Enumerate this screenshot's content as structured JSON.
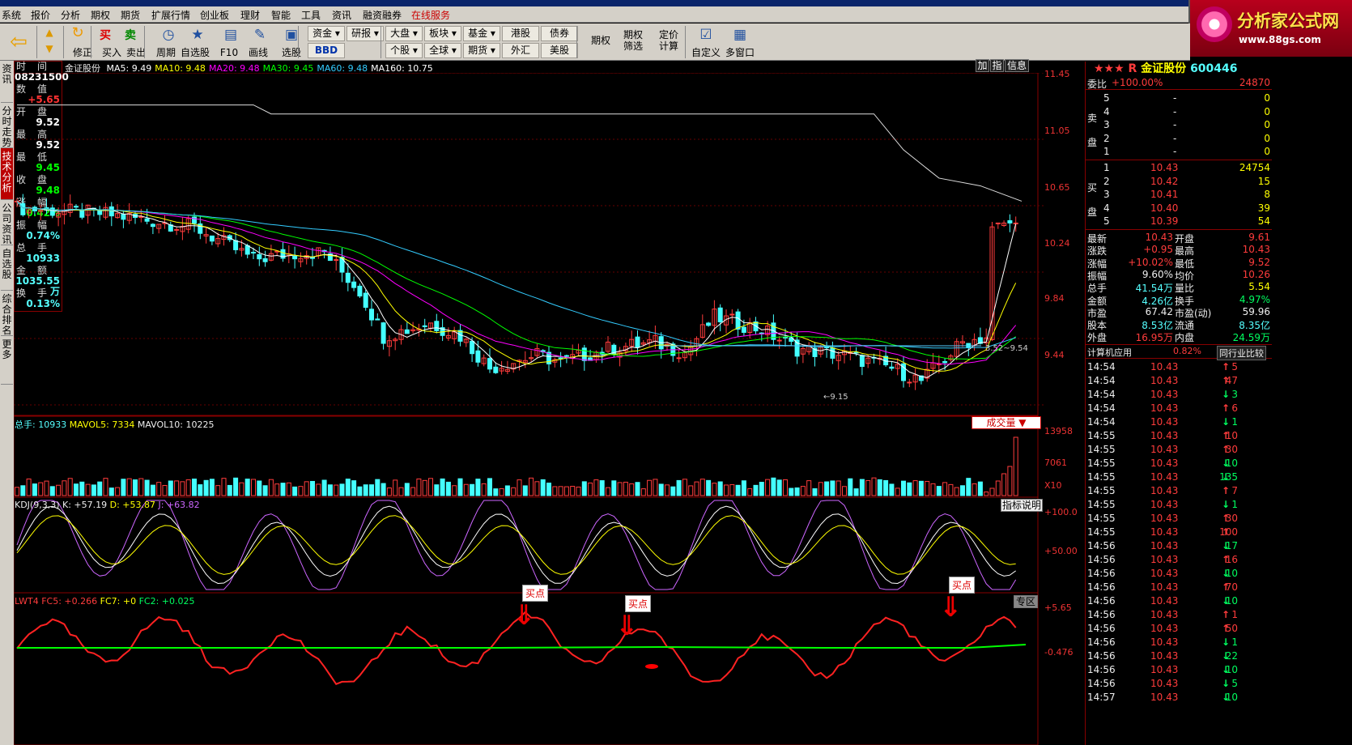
{
  "menu": [
    "系统",
    "报价",
    "分析",
    "期权",
    "期货",
    "扩展行情",
    "创业板",
    "理财",
    "智能",
    "工具",
    "资讯",
    "融资融券",
    "在线服务"
  ],
  "logo": {
    "title": "分析家公式网",
    "url": "www.88gs.com"
  },
  "toolbar": {
    "buttons": [
      "修正",
      "买入",
      "卖出",
      "周期",
      "自选股",
      "F10",
      "画线",
      "选股",
      "自定义",
      "多窗口"
    ],
    "small": [
      "资金",
      "研报",
      "大盘",
      "板块",
      "基金",
      "港股",
      "债券",
      "个股",
      "全球",
      "期货",
      "外汇",
      "美股"
    ],
    "bbd": "BBD",
    "wide": [
      "期权",
      "期权筛选",
      "定价计算"
    ],
    "buy": "买",
    "sell": "卖"
  },
  "left_tabs": [
    "资讯",
    "分时走势",
    "技术分析",
    "公司资讯",
    "自选股",
    "综合排名",
    "更多"
  ],
  "info": {
    "labels": [
      "时间",
      "数值",
      "开盘",
      "最高",
      "最低",
      "收盘",
      "涨幅",
      "振幅",
      "总手",
      "金额",
      "换手"
    ],
    "time": "08231500",
    "value": "+5.65",
    "open": "9.52",
    "high": "9.52",
    "low": "9.45",
    "close": "9.48",
    "chg": "-0.42%",
    "amp": "0.74%",
    "vol": "10933",
    "amount": "1035.55万",
    "turn": "0.13%"
  },
  "main_head": {
    "name": "金证股份",
    "ma": [
      {
        "k": "MA5:",
        "v": "9.49",
        "c": "#fff"
      },
      {
        "k": "MA10:",
        "v": "9.48",
        "c": "#ff0"
      },
      {
        "k": "MA20:",
        "v": "9.48",
        "c": "#f0f"
      },
      {
        "k": "MA30:",
        "v": "9.45",
        "c": "#0f0"
      },
      {
        "k": "MA60:",
        "v": "9.48",
        "c": "#3cf"
      },
      {
        "k": "MA160:",
        "v": "10.75",
        "c": "#fff"
      }
    ]
  },
  "main_axis": [
    "11.45",
    "11.05",
    "10.65",
    "10.24",
    "9.84",
    "9.44"
  ],
  "main_btns": [
    "加",
    "指",
    "信息"
  ],
  "annot_high": "3.52~9.54",
  "annot_low": "9.15",
  "vol_head": {
    "total": "总手: 10933",
    "mavol5": "MAVOL5: 7334",
    "mavol10": "MAVOL10: 10225"
  },
  "vol_axis": [
    "13958",
    "7061",
    "X10"
  ],
  "vol_btn": "成交量",
  "kdj_head": {
    "name": "KDJ(9,3,3)",
    "k": "K: +57.19",
    "d": "D: +53.87",
    "j": "J: +63.82"
  },
  "kdj_axis": [
    "+100.0",
    "+50.00"
  ],
  "kdj_btn": "指标说明",
  "lwt_head": {
    "name": "LWT4",
    "fc5": "FC5: +0.266",
    "fc7": "FC7: +0",
    "fc2": "FC2: +0.025"
  },
  "lwt_axis": [
    "+5.65",
    "-0.476"
  ],
  "lwt_btn": "专区",
  "buy_label": "买点",
  "right": {
    "stars": "★★★",
    "r": "R",
    "name": "金证股份",
    "code": "600446",
    "weibi_k": "委比",
    "weibi_v": "+100.00%",
    "weibi_n": "24870",
    "sell_label": "卖盘",
    "buy_label": "买盘",
    "sells": [
      {
        "lv": "5",
        "p": "-",
        "q": "0"
      },
      {
        "lv": "4",
        "p": "-",
        "q": "0"
      },
      {
        "lv": "3",
        "p": "-",
        "q": "0"
      },
      {
        "lv": "2",
        "p": "-",
        "q": "0"
      },
      {
        "lv": "1",
        "p": "-",
        "q": "0"
      }
    ],
    "buys": [
      {
        "lv": "1",
        "p": "10.43",
        "q": "24754"
      },
      {
        "lv": "2",
        "p": "10.42",
        "q": "15"
      },
      {
        "lv": "3",
        "p": "10.41",
        "q": "8"
      },
      {
        "lv": "4",
        "p": "10.40",
        "q": "39"
      },
      {
        "lv": "5",
        "p": "10.39",
        "q": "54"
      }
    ],
    "stats": [
      [
        "最新",
        "10.43",
        "开盘",
        "9.61"
      ],
      [
        "涨跌",
        "+0.95",
        "最高",
        "10.43"
      ],
      [
        "涨幅",
        "+10.02%",
        "最低",
        "9.52"
      ],
      [
        "振幅",
        "9.60%",
        "均价",
        "10.26"
      ],
      [
        "总手",
        "41.54万",
        "量比",
        "5.54"
      ],
      [
        "金额",
        "4.26亿",
        "换手",
        "4.97%"
      ],
      [
        "市盈",
        "67.42",
        "市盈(动)",
        "59.96"
      ],
      [
        "股本",
        "8.53亿",
        "流通",
        "8.35亿"
      ],
      [
        "外盘",
        "16.95万",
        "内盘",
        "24.59万"
      ]
    ],
    "sector": "计算机应用",
    "sector_chg": "0.82%",
    "compare": "同行业比较",
    "ticks": [
      [
        "14:54",
        "10.43",
        "5",
        "up"
      ],
      [
        "14:54",
        "10.43",
        "47",
        "up"
      ],
      [
        "14:54",
        "10.43",
        "3",
        "dn"
      ],
      [
        "14:54",
        "10.43",
        "6",
        "up"
      ],
      [
        "14:54",
        "10.43",
        "1",
        "dn"
      ],
      [
        "14:55",
        "10.43",
        "10",
        "up"
      ],
      [
        "14:55",
        "10.43",
        "30",
        "up"
      ],
      [
        "14:55",
        "10.43",
        "10",
        "dn"
      ],
      [
        "14:55",
        "10.43",
        "135",
        "dn"
      ],
      [
        "14:55",
        "10.43",
        "7",
        "up"
      ],
      [
        "14:55",
        "10.43",
        "1",
        "dn"
      ],
      [
        "14:55",
        "10.43",
        "30",
        "up"
      ],
      [
        "14:55",
        "10.43",
        "100",
        "up"
      ],
      [
        "14:56",
        "10.43",
        "17",
        "dn"
      ],
      [
        "14:56",
        "10.43",
        "16",
        "up"
      ],
      [
        "14:56",
        "10.43",
        "10",
        "dn"
      ],
      [
        "14:56",
        "10.43",
        "70",
        "up"
      ],
      [
        "14:56",
        "10.43",
        "10",
        "dn"
      ],
      [
        "14:56",
        "10.43",
        "1",
        "up"
      ],
      [
        "14:56",
        "10.43",
        "50",
        "up"
      ],
      [
        "14:56",
        "10.43",
        "1",
        "dn"
      ],
      [
        "14:56",
        "10.43",
        "22",
        "dn"
      ],
      [
        "14:56",
        "10.43",
        "10",
        "dn"
      ],
      [
        "14:56",
        "10.43",
        "5",
        "dn"
      ],
      [
        "14:57",
        "10.43",
        "10",
        "dn"
      ]
    ]
  }
}
